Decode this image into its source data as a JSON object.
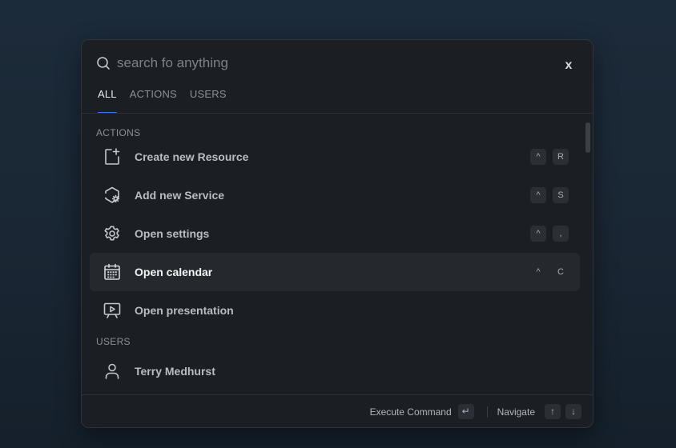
{
  "search": {
    "placeholder": "search fo anything",
    "value": "",
    "close_label": "x"
  },
  "tabs": [
    {
      "label": "ALL",
      "active": true
    },
    {
      "label": "ACTIONS",
      "active": false
    },
    {
      "label": "USERS",
      "active": false
    }
  ],
  "sections": {
    "actions_header": "ACTIONS",
    "users_header": "USERS"
  },
  "actions": [
    {
      "label": "Create new Resource",
      "icon": "file-plus-icon",
      "keys": [
        "^",
        "R"
      ]
    },
    {
      "label": "Add new Service",
      "icon": "hexagon-gear-icon",
      "keys": [
        "^",
        "S"
      ]
    },
    {
      "label": "Open settings",
      "icon": "gear-icon",
      "keys": [
        "^",
        ","
      ]
    },
    {
      "label": "Open calendar",
      "icon": "calendar-icon",
      "keys": [
        "^",
        "C"
      ],
      "selected": true
    },
    {
      "label": "Open presentation",
      "icon": "presentation-icon",
      "keys": []
    }
  ],
  "users": [
    {
      "label": "Terry Medhurst",
      "icon": "user-icon"
    }
  ],
  "footer": {
    "execute_label": "Execute Command",
    "execute_key": "↵",
    "navigate_label": "Navigate",
    "up_key": "↑",
    "down_key": "↓"
  },
  "colors": {
    "accent": "#2f7ae5",
    "panel": "#1b1e22",
    "selected_row": "#25282d"
  }
}
